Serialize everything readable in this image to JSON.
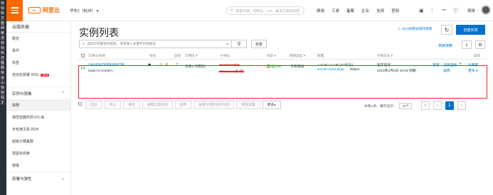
{
  "left_strip": [
    "快",
    "快",
    "快",
    "文",
    "盤",
    "网",
    "散",
    "流",
    "快",
    "快",
    "快",
    "还",
    "盤",
    "微",
    "快",
    "运",
    "山",
    "快",
    "快",
    "强",
    "正"
  ],
  "topbar": {
    "logo_text": "阿里云",
    "region": "华东1（杭州） ▾",
    "search_placeholder": "搜索文档、控制台、API、解决方案和资源",
    "nav": [
      "费用",
      "工单",
      "备案",
      "企业",
      "支持",
      "官网"
    ],
    "lang": "简体"
  },
  "sidebar": {
    "title": "云服务器",
    "items_top": [
      "概览",
      "事件",
      "标签",
      "自动化部署 ROS"
    ],
    "ros_badge": "NEW",
    "group1": "实例与镜像",
    "group1_items": [
      "实例",
      "弹性容器实例 ECI ⧉",
      "专有宿主机 DDH",
      "超级计算集群",
      "预留实例券",
      "镜像"
    ],
    "group2": "部署与弹性"
  },
  "main": {
    "title": "实例列表",
    "ops_guide": "ECS控制台操作指南",
    "create_label": "创建实例",
    "filter_placeholder": "选择实例属性项搜索，或者输入关键字识别搜索",
    "tag_label": "标签",
    "advanced_search": "高级搜索",
    "columns": [
      "实例ID/名称",
      "标签",
      "监控",
      "可用区 ▾",
      "IP地址",
      "状态 ▾",
      "网络类型 ▾",
      "配置",
      "付费方式 ▾",
      "操作"
    ],
    "row": {
      "id": "i-bp183a79rbtbv0k5795",
      "name": "largeAICould2H...",
      "zone": "华东1 可用区I",
      "ip1": "•••.••.•••.••(公)",
      "ip2": "172.••.••.••(私有)",
      "status": "运行中",
      "network": "专有网络",
      "config_spec": "2 vCPU 4 GiB (I/O优化)",
      "config_type": "ecs.t5-c1m2.large",
      "config_bw": "3Mbps",
      "billing": "包年包月",
      "expire": "2023年2月5日 23:59 到期",
      "actions": [
        "管理",
        "远程连接",
        "升降配",
        "续费",
        "更多"
      ]
    },
    "bottom_buttons": [
      "启动",
      "停止",
      "重启",
      "重置实例密码",
      "续费",
      "按量付费转包年包月",
      "释放设置",
      "更多▴"
    ],
    "pager_text": "共有1条，每页显示：",
    "page_size": "20",
    "current_page": "1"
  }
}
